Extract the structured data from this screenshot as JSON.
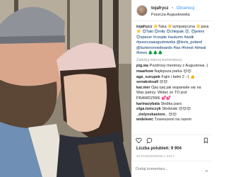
{
  "post": {
    "username": "tojafrycz",
    "separator": "•",
    "follow_label": "Obserwuj",
    "location": "Puszcza Augustowska"
  },
  "caption": {
    "username": "tojafrycz",
    "text": "☀️Taka ☀️sympatyczna ☀️para ☀️",
    "hashtags": "😊Taki 😊miły 😊chłopak 😊, 😊jeleni 😊spacer #couple #autumn #walk #puszczaaugustowska @levis_poland @burtonsnowboards #las #forest #drwal #trees 🌲🌲🌲"
  },
  "load_more_label": "Załaduj więcej komentarzy",
  "comments": [
    {
      "user": "pig.wa",
      "text": "Pozdrosy mentosy z Augustowa :)"
    },
    {
      "user": "maarkow",
      "text": "Najlepsza parka 😍😍"
    },
    {
      "user": "aga_surupek",
      "text": "Fajni i ładni 2 :-) 👍"
    },
    {
      "user": "senakoksall",
      "text": "😍😍"
    },
    {
      "user": "kat.mer",
      "text": "Ojej ojej jak wspaniale się na Was patrzy. Widać że TO jest PRAWDZIWE 💕💕"
    },
    {
      "user": "karinazybala",
      "text": "Słodka para"
    },
    {
      "user": "olga.tomczyk",
      "text": "Słodziaki 😍😍😍"
    },
    {
      "user": "_zielynskastore_",
      "text": "😍😍"
    },
    {
      "user": "widelewc",
      "text": "Tzareszenii na razem"
    }
  ],
  "likes_label": "Liczba polubień: 9 904",
  "date": "20 PAŹDZIERNIKA 2017",
  "add_comment_placeholder": "Dodaj komentarz...",
  "more_label": "..."
}
